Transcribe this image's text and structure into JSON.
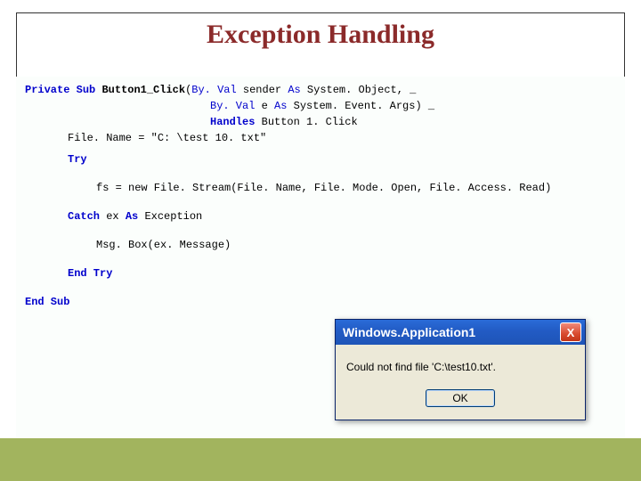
{
  "title": "Exception Handling",
  "code": {
    "kw_private": "Private",
    "kw_sub": "Sub",
    "method_name": "Button1_Click",
    "kw_byval": "By. Val",
    "param1_name": "sender",
    "kw_as": "As",
    "param1_type": "System. Object",
    "line_cont": "_",
    "param2_name": "e",
    "param2_type": "System. Event. Args",
    "kw_handles": "Handles",
    "handles_target": "Button 1. Click",
    "assign_line": "File. Name = \"C: \\test 10. txt\"",
    "kw_try": "Try",
    "fs_line": "fs = new File. Stream(File. Name, File. Mode. Open, File. Access. Read)",
    "kw_catch": "Catch",
    "catch_var": "ex",
    "catch_type": "Exception",
    "msgbox_call": "Msg. Box(ex. Message)",
    "kw_end_try": "End Try",
    "kw_end_sub": "End Sub"
  },
  "dialog": {
    "title": "Windows.Application1",
    "message": "Could not find file 'C:\\test10.txt'.",
    "ok_label": "OK",
    "close_glyph": "X"
  }
}
